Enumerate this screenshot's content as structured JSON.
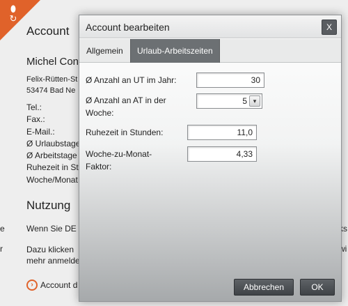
{
  "background": {
    "title": "Account",
    "name": "Michel Cons",
    "address": [
      "Felix-Rütten-St",
      "53474 Bad Ne"
    ],
    "fields": [
      "Tel.:",
      "Fax.:",
      "E-Mail.:",
      "Ø Urlaubstage",
      "Ø Arbeitstage",
      "Ruhezeit in St",
      "Woche/Monat"
    ],
    "usage_title": "Nutzung",
    "usage_text1": "Wenn Sie DE",
    "usage_text2_line1": "Dazu klicken",
    "usage_text2_line2": "mehr anmelde",
    "edge_left": [
      "e",
      "r"
    ],
    "edge_right": [
      "ks",
      "wi"
    ],
    "account_link": "Account d",
    "logo_glyphs": [
      "⬮",
      "↻"
    ]
  },
  "dialog": {
    "title": "Account bearbeiten",
    "close_label": "X",
    "tabs": [
      {
        "label": "Allgemein",
        "active": false
      },
      {
        "label": "Urlaub-Arbeitszeiten",
        "active": true
      }
    ],
    "fields": {
      "ut_label": "Ø Anzahl an UT im Jahr:",
      "ut_value": "30",
      "at_label_line1": "Ø Anzahl an AT in der",
      "at_label_line2": "Woche:",
      "at_value": "5",
      "at_arrow": "▾",
      "rest_label": "Ruhezeit in Stunden:",
      "rest_value": "11,0",
      "factor_label_line1": "Woche-zu-Monat-",
      "factor_label_line2": "Faktor:",
      "factor_value": "4,33"
    },
    "buttons": {
      "cancel": "Abbrechen",
      "ok": "OK"
    }
  },
  "colors": {
    "accent": "#e0622a",
    "active_tab": "#6c7073",
    "button": "#4a4e52"
  }
}
